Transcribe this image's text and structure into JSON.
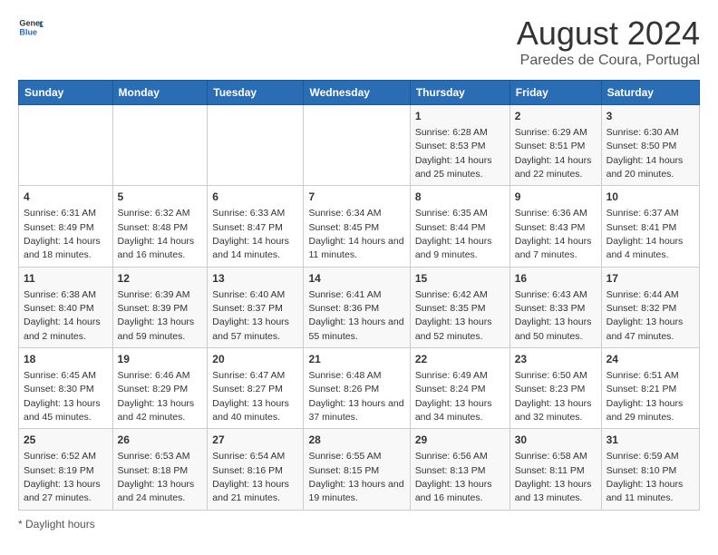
{
  "header": {
    "logo_text_general": "General",
    "logo_text_blue": "Blue",
    "main_title": "August 2024",
    "sub_title": "Paredes de Coura, Portugal"
  },
  "footer": {
    "daylight_label": "Daylight hours"
  },
  "calendar": {
    "days_of_week": [
      "Sunday",
      "Monday",
      "Tuesday",
      "Wednesday",
      "Thursday",
      "Friday",
      "Saturday"
    ],
    "weeks": [
      [
        {
          "day": "",
          "info": ""
        },
        {
          "day": "",
          "info": ""
        },
        {
          "day": "",
          "info": ""
        },
        {
          "day": "",
          "info": ""
        },
        {
          "day": "1",
          "info": "Sunrise: 6:28 AM\nSunset: 8:53 PM\nDaylight: 14 hours and 25 minutes."
        },
        {
          "day": "2",
          "info": "Sunrise: 6:29 AM\nSunset: 8:51 PM\nDaylight: 14 hours and 22 minutes."
        },
        {
          "day": "3",
          "info": "Sunrise: 6:30 AM\nSunset: 8:50 PM\nDaylight: 14 hours and 20 minutes."
        }
      ],
      [
        {
          "day": "4",
          "info": "Sunrise: 6:31 AM\nSunset: 8:49 PM\nDaylight: 14 hours and 18 minutes."
        },
        {
          "day": "5",
          "info": "Sunrise: 6:32 AM\nSunset: 8:48 PM\nDaylight: 14 hours and 16 minutes."
        },
        {
          "day": "6",
          "info": "Sunrise: 6:33 AM\nSunset: 8:47 PM\nDaylight: 14 hours and 14 minutes."
        },
        {
          "day": "7",
          "info": "Sunrise: 6:34 AM\nSunset: 8:45 PM\nDaylight: 14 hours and 11 minutes."
        },
        {
          "day": "8",
          "info": "Sunrise: 6:35 AM\nSunset: 8:44 PM\nDaylight: 14 hours and 9 minutes."
        },
        {
          "day": "9",
          "info": "Sunrise: 6:36 AM\nSunset: 8:43 PM\nDaylight: 14 hours and 7 minutes."
        },
        {
          "day": "10",
          "info": "Sunrise: 6:37 AM\nSunset: 8:41 PM\nDaylight: 14 hours and 4 minutes."
        }
      ],
      [
        {
          "day": "11",
          "info": "Sunrise: 6:38 AM\nSunset: 8:40 PM\nDaylight: 14 hours and 2 minutes."
        },
        {
          "day": "12",
          "info": "Sunrise: 6:39 AM\nSunset: 8:39 PM\nDaylight: 13 hours and 59 minutes."
        },
        {
          "day": "13",
          "info": "Sunrise: 6:40 AM\nSunset: 8:37 PM\nDaylight: 13 hours and 57 minutes."
        },
        {
          "day": "14",
          "info": "Sunrise: 6:41 AM\nSunset: 8:36 PM\nDaylight: 13 hours and 55 minutes."
        },
        {
          "day": "15",
          "info": "Sunrise: 6:42 AM\nSunset: 8:35 PM\nDaylight: 13 hours and 52 minutes."
        },
        {
          "day": "16",
          "info": "Sunrise: 6:43 AM\nSunset: 8:33 PM\nDaylight: 13 hours and 50 minutes."
        },
        {
          "day": "17",
          "info": "Sunrise: 6:44 AM\nSunset: 8:32 PM\nDaylight: 13 hours and 47 minutes."
        }
      ],
      [
        {
          "day": "18",
          "info": "Sunrise: 6:45 AM\nSunset: 8:30 PM\nDaylight: 13 hours and 45 minutes."
        },
        {
          "day": "19",
          "info": "Sunrise: 6:46 AM\nSunset: 8:29 PM\nDaylight: 13 hours and 42 minutes."
        },
        {
          "day": "20",
          "info": "Sunrise: 6:47 AM\nSunset: 8:27 PM\nDaylight: 13 hours and 40 minutes."
        },
        {
          "day": "21",
          "info": "Sunrise: 6:48 AM\nSunset: 8:26 PM\nDaylight: 13 hours and 37 minutes."
        },
        {
          "day": "22",
          "info": "Sunrise: 6:49 AM\nSunset: 8:24 PM\nDaylight: 13 hours and 34 minutes."
        },
        {
          "day": "23",
          "info": "Sunrise: 6:50 AM\nSunset: 8:23 PM\nDaylight: 13 hours and 32 minutes."
        },
        {
          "day": "24",
          "info": "Sunrise: 6:51 AM\nSunset: 8:21 PM\nDaylight: 13 hours and 29 minutes."
        }
      ],
      [
        {
          "day": "25",
          "info": "Sunrise: 6:52 AM\nSunset: 8:19 PM\nDaylight: 13 hours and 27 minutes."
        },
        {
          "day": "26",
          "info": "Sunrise: 6:53 AM\nSunset: 8:18 PM\nDaylight: 13 hours and 24 minutes."
        },
        {
          "day": "27",
          "info": "Sunrise: 6:54 AM\nSunset: 8:16 PM\nDaylight: 13 hours and 21 minutes."
        },
        {
          "day": "28",
          "info": "Sunrise: 6:55 AM\nSunset: 8:15 PM\nDaylight: 13 hours and 19 minutes."
        },
        {
          "day": "29",
          "info": "Sunrise: 6:56 AM\nSunset: 8:13 PM\nDaylight: 13 hours and 16 minutes."
        },
        {
          "day": "30",
          "info": "Sunrise: 6:58 AM\nSunset: 8:11 PM\nDaylight: 13 hours and 13 minutes."
        },
        {
          "day": "31",
          "info": "Sunrise: 6:59 AM\nSunset: 8:10 PM\nDaylight: 13 hours and 11 minutes."
        }
      ]
    ]
  }
}
